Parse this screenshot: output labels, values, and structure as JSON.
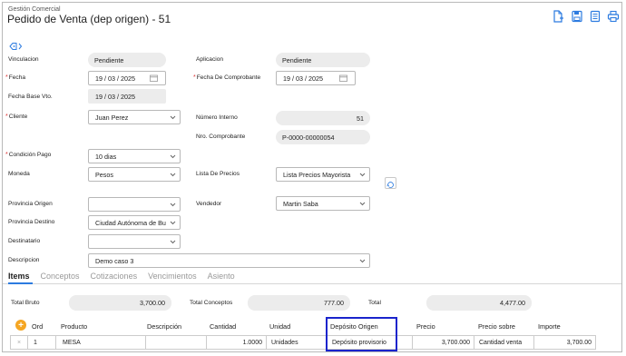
{
  "header": {
    "app_name": "Gestión Comercial",
    "title": "Pedido de Venta (dep origen) - 51",
    "icons": [
      "new-document-icon",
      "save-icon",
      "document-list-icon",
      "print-icon"
    ]
  },
  "form": {
    "vinculacion": {
      "label": "Vinculacion",
      "value": "Pendiente"
    },
    "aplicacion": {
      "label": "Aplicacion",
      "value": "Pendiente"
    },
    "fecha": {
      "label": "Fecha",
      "value": "19 / 03 / 2025"
    },
    "fecha_comprobante": {
      "label": "Fecha De Comprobante",
      "value": "19 / 03 / 2025"
    },
    "fecha_base_vto": {
      "label": "Fecha Base Vto.",
      "value": "19 / 03 / 2025"
    },
    "cliente": {
      "label": "Cliente",
      "value": "Juan Perez"
    },
    "numero_interno": {
      "label": "Número Interno",
      "value": "51"
    },
    "nro_comprobante": {
      "label": "Nro. Comprobante",
      "value": "P-0000-00000054"
    },
    "condicion_pago": {
      "label": "Condición Pago",
      "value": "10 dias"
    },
    "moneda": {
      "label": "Moneda",
      "value": "Pesos"
    },
    "lista_precios": {
      "label": "Lista De Precios",
      "value": "Lista Precios Mayorista"
    },
    "provincia_origen": {
      "label": "Provincia Origen",
      "value": ""
    },
    "vendedor": {
      "label": "Vendedor",
      "value": "Martin Saba"
    },
    "provincia_destino": {
      "label": "Provincia Destino",
      "value": "Ciudad Autónoma de Bu"
    },
    "destinatario": {
      "label": "Destinatario",
      "value": ""
    },
    "descripcion": {
      "label": "Descripcion",
      "value": "Demo caso 3"
    }
  },
  "tabs": [
    {
      "label": "Items",
      "active": true
    },
    {
      "label": "Conceptos",
      "active": false
    },
    {
      "label": "Cotizaciones",
      "active": false
    },
    {
      "label": "Vencimientos",
      "active": false
    },
    {
      "label": "Asiento",
      "active": false
    }
  ],
  "totals": {
    "total_bruto": {
      "label": "Total Bruto",
      "value": "3,700.00"
    },
    "total_conceptos": {
      "label": "Total Conceptos",
      "value": "777.00"
    },
    "total": {
      "label": "Total",
      "value": "4,477.00"
    }
  },
  "grid": {
    "add_symbol": "+",
    "columns": [
      "Ord",
      "Producto",
      "Descripción",
      "Cantidad",
      "Unidad",
      "Depósito Origen",
      "Precio",
      "Precio sobre",
      "Importe"
    ],
    "rows": [
      {
        "remove": "×",
        "ord": "1",
        "producto": "MESA",
        "descripcion": "",
        "cantidad": "1.0000",
        "unidad": "Unidades",
        "deposito_origen": "Depósito provisorio",
        "precio": "3,700.000",
        "precio_sobre": "Cantidad venta",
        "importe": "3,700.00"
      }
    ]
  },
  "colors": {
    "accent": "#2c7be0",
    "highlight_box": "#1a24cc",
    "add_button": "#f5a623",
    "required": "#dd3333"
  }
}
